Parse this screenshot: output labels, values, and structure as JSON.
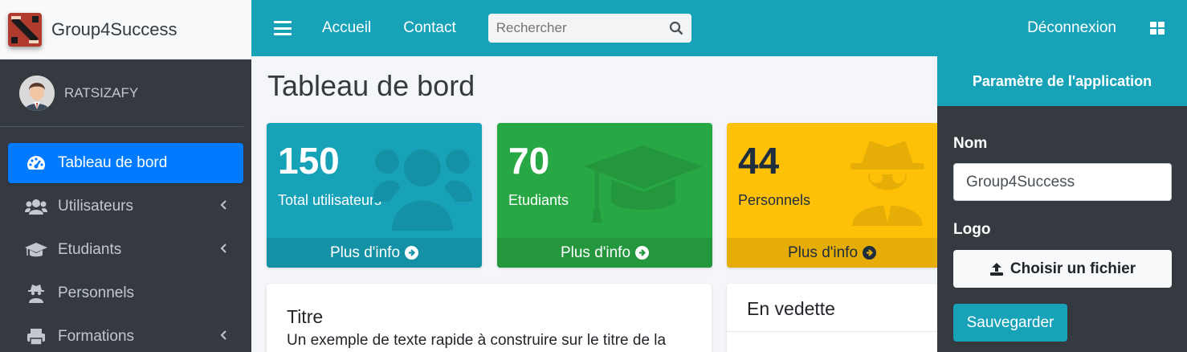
{
  "brand": {
    "name": "Group4Success",
    "logo_icon": "dota-logo-icon"
  },
  "user": {
    "name": "RATSIZAFY"
  },
  "sidebar": {
    "items": [
      {
        "label": "Tableau de bord",
        "icon": "tachometer-icon",
        "active": true,
        "has_children": false
      },
      {
        "label": "Utilisateurs",
        "icon": "users-icon",
        "active": false,
        "has_children": true
      },
      {
        "label": "Etudiants",
        "icon": "graduation-cap-icon",
        "active": false,
        "has_children": true
      },
      {
        "label": "Personnels",
        "icon": "user-secret-icon",
        "active": false,
        "has_children": false
      },
      {
        "label": "Formations",
        "icon": "print-icon",
        "active": false,
        "has_children": true
      }
    ]
  },
  "navbar": {
    "links": [
      "Accueil",
      "Contact"
    ],
    "search_placeholder": "Rechercher",
    "logout": "Déconnexion"
  },
  "main": {
    "title": "Tableau de bord",
    "boxes": [
      {
        "value": "150",
        "label": "Total utilisateurs",
        "footer": "Plus d'info",
        "color": "#17a2b8",
        "icon": "users-icon"
      },
      {
        "value": "70",
        "label": "Etudiants",
        "footer": "Plus d'info",
        "color": "#28a745",
        "icon": "graduation-cap-icon"
      },
      {
        "value": "44",
        "label": "Personnels",
        "footer": "Plus d'info",
        "color": "#ffc107",
        "icon": "user-secret-icon"
      }
    ],
    "card1": {
      "title": "Titre",
      "text": "Un exemple de texte rapide à construire sur le titre de la"
    },
    "card2": {
      "title": "En vedette"
    }
  },
  "control": {
    "header": "Paramètre de l'application",
    "name_label": "Nom",
    "name_value": "Group4Success",
    "logo_label": "Logo",
    "file_button": "Choisir un fichier",
    "save_button": "Sauvegarder"
  },
  "colors": {
    "primary": "#007bff",
    "info": "#17a2b8",
    "success": "#28a745",
    "warning": "#ffc107",
    "dark": "#343a40"
  }
}
